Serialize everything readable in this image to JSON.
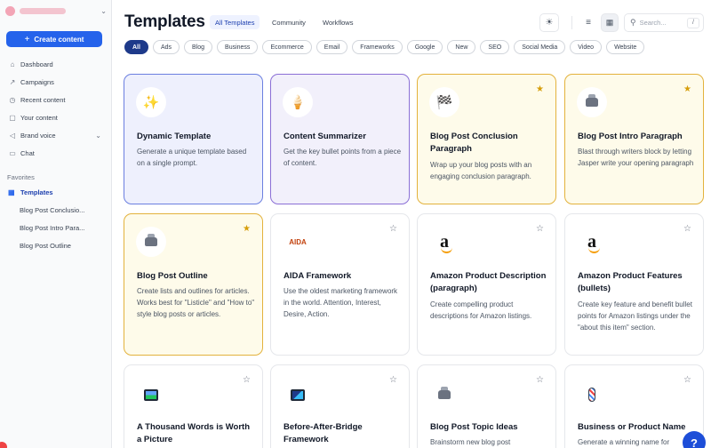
{
  "sidebar": {
    "create_label": "Create content",
    "nav": [
      {
        "label": "Dashboard",
        "icon": "home-icon"
      },
      {
        "label": "Campaigns",
        "icon": "rocket-icon"
      },
      {
        "label": "Recent content",
        "icon": "clock-icon"
      },
      {
        "label": "Your content",
        "icon": "lock-icon"
      },
      {
        "label": "Brand voice",
        "icon": "megaphone-icon"
      },
      {
        "label": "Chat",
        "icon": "chat-icon"
      }
    ],
    "favorites_title": "Favorites",
    "favorites": [
      {
        "label": "Templates"
      },
      {
        "label": "Blog Post Conclusio..."
      },
      {
        "label": "Blog Post Intro Para..."
      },
      {
        "label": "Blog Post Outline"
      }
    ]
  },
  "header": {
    "title": "Templates",
    "tabs": [
      "All Templates",
      "Community",
      "Workflows"
    ],
    "search_placeholder": "Search...",
    "search_shortcut": "/"
  },
  "filters": [
    "All",
    "Ads",
    "Blog",
    "Business",
    "Ecommerce",
    "Email",
    "Frameworks",
    "Google",
    "New",
    "SEO",
    "Social Media",
    "Video",
    "Website"
  ],
  "cards": [
    {
      "title": "Dynamic Template",
      "desc": "Generate a unique template based on a single prompt.",
      "icon": "sparkles-icon",
      "starred": false
    },
    {
      "title": "Content Summarizer",
      "desc": "Get the key bullet points from a piece of content.",
      "icon": "ice-cream-icon",
      "starred": false
    },
    {
      "title": "Blog Post Conclusion Paragraph",
      "desc": "Wrap up your blog posts with an engaging conclusion paragraph.",
      "icon": "checkered-flag-icon",
      "starred": true
    },
    {
      "title": "Blog Post Intro Paragraph",
      "desc": "Blast through writers block by letting Jasper write your opening paragraph",
      "icon": "toolbox-icon",
      "starred": true
    },
    {
      "title": "Blog Post Outline",
      "desc": "Create lists and outlines for articles. Works best for \"Listicle\" and \"How to\" style blog posts or articles.",
      "icon": "toolbox-icon",
      "starred": true
    },
    {
      "title": "AIDA Framework",
      "desc": "Use the oldest marketing framework in the world. Attention, Interest, Desire, Action.",
      "icon": "aida-logo-icon",
      "logo_text": "AIDA",
      "starred": false
    },
    {
      "title": "Amazon Product Description (paragraph)",
      "desc": "Create compelling product descriptions for Amazon listings.",
      "icon": "amazon-logo-icon",
      "logo_text": "a",
      "starred": false
    },
    {
      "title": "Amazon Product Features (bullets)",
      "desc": "Create key feature and benefit bullet points for Amazon listings under the \"about this item\" section.",
      "icon": "amazon-logo-icon",
      "logo_text": "a",
      "starred": false
    },
    {
      "title": "A Thousand Words is Worth a Picture",
      "desc": "",
      "icon": "framed-picture-icon",
      "starred": false
    },
    {
      "title": "Before-After-Bridge Framework",
      "desc": "",
      "icon": "framed-picture-icon",
      "starred": false
    },
    {
      "title": "Blog Post Topic Ideas",
      "desc": "Brainstorm new blog post",
      "icon": "toolbox-icon",
      "starred": false
    },
    {
      "title": "Business or Product Name",
      "desc": "Generate a winning name for",
      "icon": "barber-pole-icon",
      "starred": false
    }
  ],
  "colors": {
    "accent": "#2563eb",
    "active_chip": "#1e3a8a",
    "star": "#d69e0b"
  }
}
